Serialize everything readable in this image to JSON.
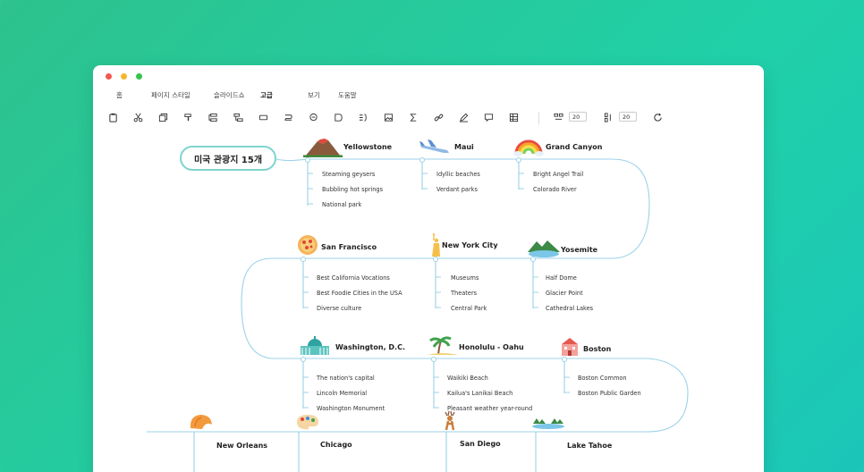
{
  "menu": [
    "홈",
    "페이지 스타일",
    "슬라이드쇼",
    "고급",
    "보기",
    "도움말"
  ],
  "menu_active": "고급",
  "toolbar": {
    "spacing_h": "20",
    "spacing_v": "20"
  },
  "root": "미국 관광지 15개",
  "topics": [
    {
      "title": "Yellowstone",
      "icon": "volcano-icon",
      "items": [
        "Steaming geysers",
        "Bubbling hot springs",
        "National park"
      ]
    },
    {
      "title": "Maui",
      "icon": "airplane-icon",
      "items": [
        "Idyllic beaches",
        "Verdant parks"
      ]
    },
    {
      "title": "Grand Canyon",
      "icon": "rainbow-icon",
      "items": [
        "Bright Angel Trail",
        "Colorado River"
      ]
    },
    {
      "title": "San Francisco",
      "icon": "pizza-icon",
      "items": [
        "Best California Vocations",
        "Best Foodie Cities in the USA",
        "Diverse culture"
      ]
    },
    {
      "title": "New York City",
      "icon": "statue-of-liberty-icon",
      "items": [
        "Museums",
        "Theaters",
        "Central Park"
      ]
    },
    {
      "title": "Yosemite",
      "icon": "mountain-lake-icon",
      "items": [
        "Half Dome",
        "Glacier Point",
        "Cathedral Lakes"
      ]
    },
    {
      "title": "Washington, D.C.",
      "icon": "capitol-icon",
      "items": [
        "The nation's capital",
        "Lincoln Memorial",
        "Washington Monument"
      ]
    },
    {
      "title": "Honolulu - Oahu",
      "icon": "palm-tree-icon",
      "items": [
        "Waikiki Beach",
        "Kailua's Lanikai Beach",
        "Pleasant weather year-round"
      ]
    },
    {
      "title": "Boston",
      "icon": "building-icon",
      "items": [
        "Boston Common",
        "Boston Public Garden"
      ]
    },
    {
      "title": "New Orleans",
      "icon": "shell-icon",
      "items": []
    },
    {
      "title": "Chicago",
      "icon": "palette-icon",
      "items": []
    },
    {
      "title": "San Diego",
      "icon": "deer-icon",
      "items": []
    },
    {
      "title": "Lake Tahoe",
      "icon": "lake-icon",
      "items": []
    }
  ]
}
